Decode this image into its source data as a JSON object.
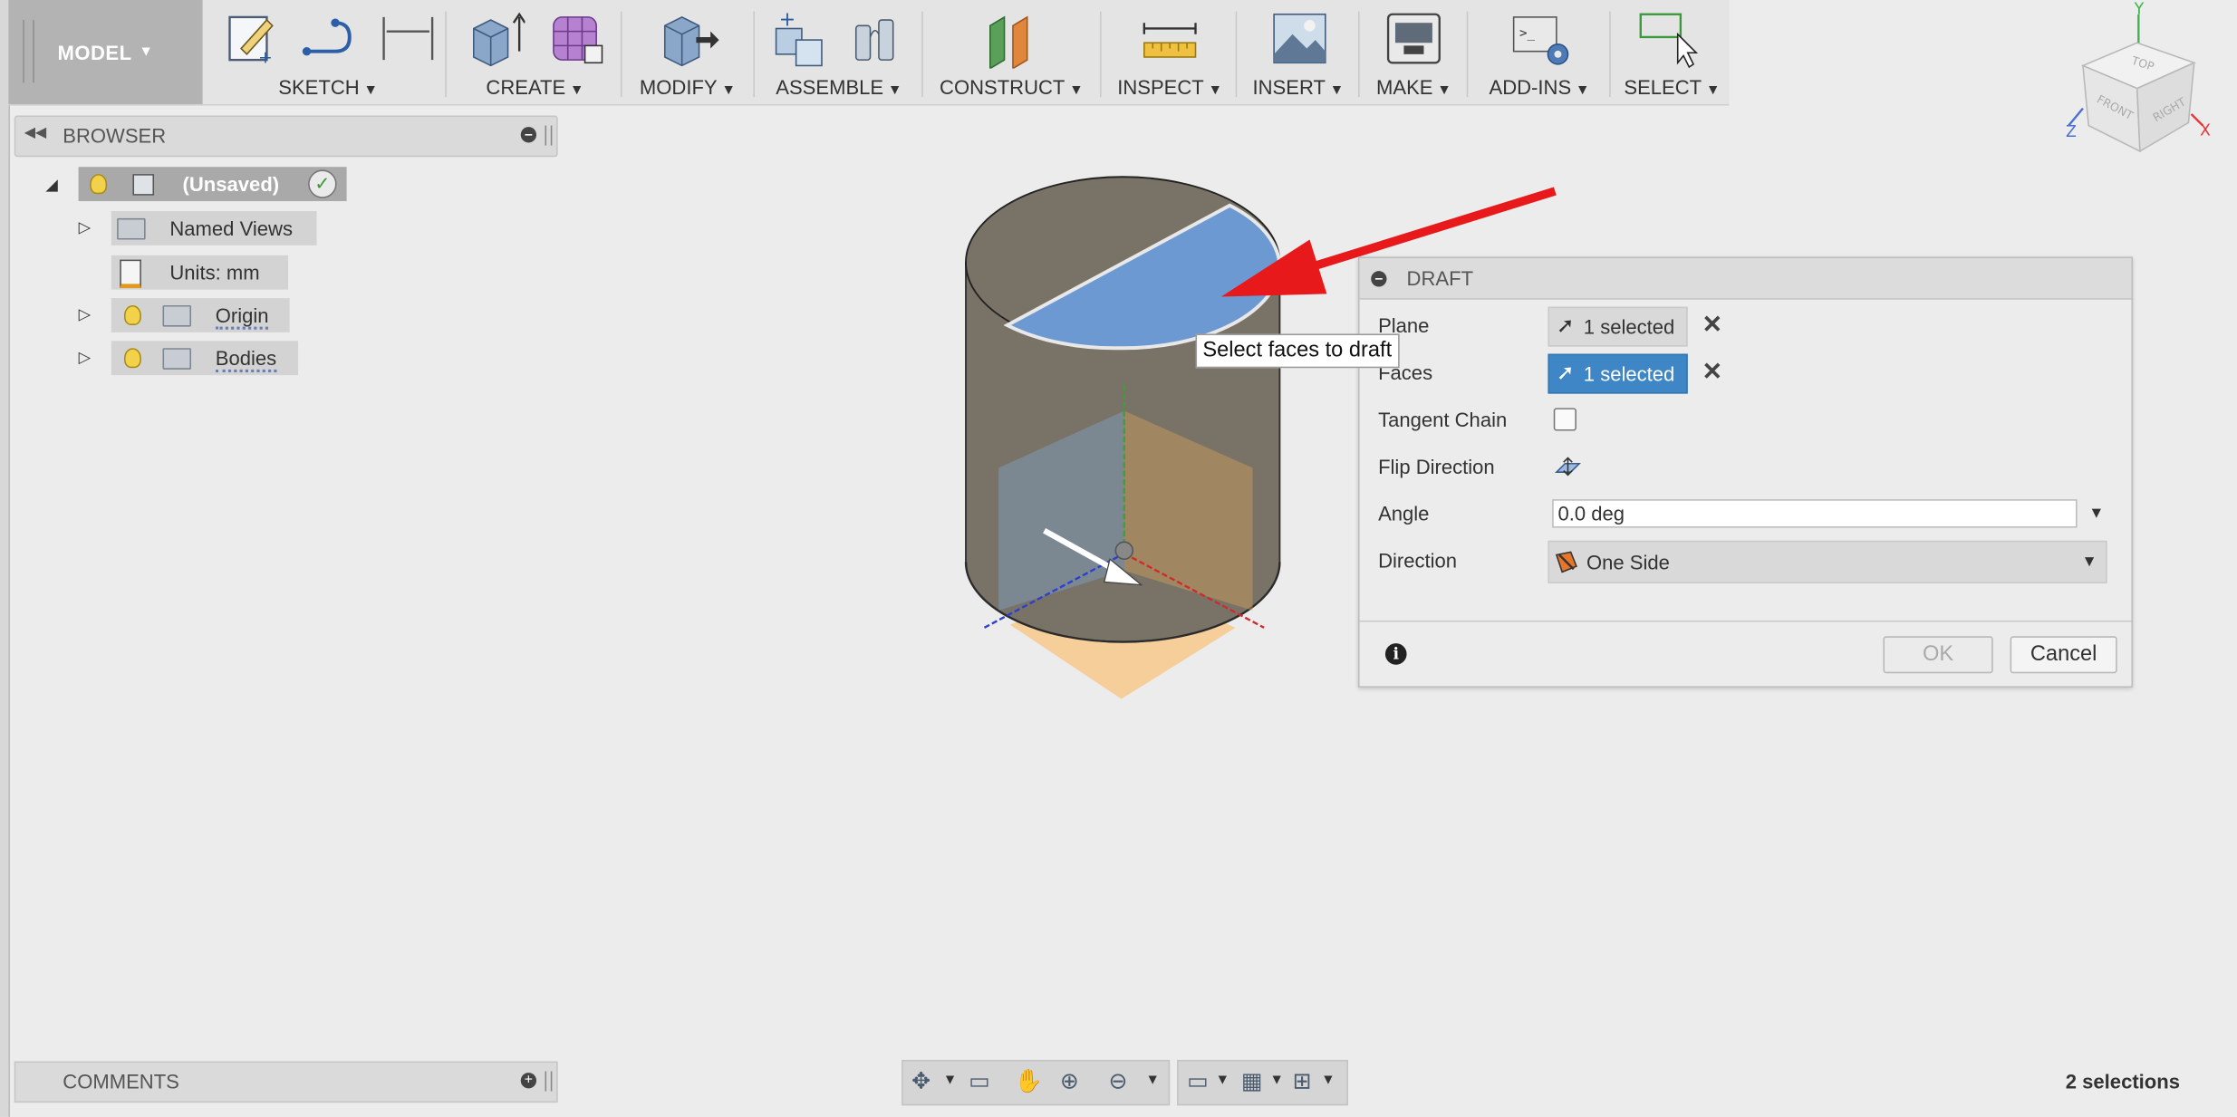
{
  "toolbar": {
    "model_label": "MODEL",
    "groups": [
      {
        "label": "SKETCH"
      },
      {
        "label": "CREATE"
      },
      {
        "label": "MODIFY"
      },
      {
        "label": "ASSEMBLE"
      },
      {
        "label": "CONSTRUCT"
      },
      {
        "label": "INSPECT"
      },
      {
        "label": "INSERT"
      },
      {
        "label": "MAKE"
      },
      {
        "label": "ADD-INS"
      },
      {
        "label": "SELECT"
      }
    ]
  },
  "viewcube": {
    "axes": {
      "y": "Y",
      "x": "X",
      "z": "Z"
    },
    "faces": {
      "top": "TOP",
      "front": "FRONT",
      "right": "RIGHT"
    }
  },
  "browser": {
    "title": "BROWSER",
    "root": "(Unsaved)",
    "items": [
      {
        "label": "Named Views"
      },
      {
        "label": "Units: mm"
      },
      {
        "label": "Origin"
      },
      {
        "label": "Bodies"
      }
    ]
  },
  "comments": {
    "title": "COMMENTS"
  },
  "status": {
    "selections": "2 selections"
  },
  "tooltip": "Select faces to draft",
  "draft": {
    "title": "DRAFT",
    "rows": {
      "plane_label": "Plane",
      "plane_value": "1 selected",
      "faces_label": "Faces",
      "faces_value": "1 selected",
      "tangent_label": "Tangent Chain",
      "tangent_checked": false,
      "flip_label": "Flip Direction",
      "angle_label": "Angle",
      "angle_value": "0.0 deg",
      "direction_label": "Direction",
      "direction_value": "One Side"
    },
    "ok_label": "OK",
    "cancel_label": "Cancel"
  },
  "colors": {
    "accent_blue": "#3f86c6",
    "arrow_red": "#e8191b",
    "cylinder_grey": "#7a7468",
    "selected_face": "#6c98d2"
  }
}
